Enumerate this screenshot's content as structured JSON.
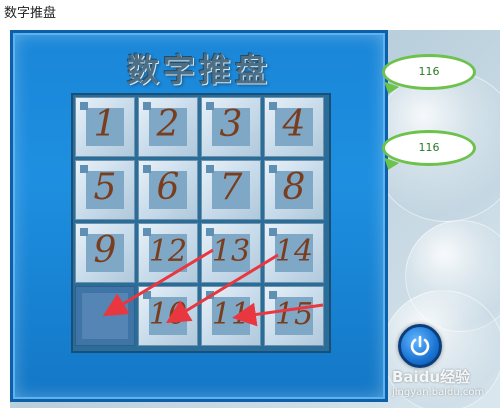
{
  "page": {
    "title": "数字推盘"
  },
  "game": {
    "title": "数字推盘",
    "tiles": [
      {
        "label": "1",
        "row": 0,
        "col": 0
      },
      {
        "label": "2",
        "row": 0,
        "col": 1
      },
      {
        "label": "3",
        "row": 0,
        "col": 2
      },
      {
        "label": "4",
        "row": 0,
        "col": 3
      },
      {
        "label": "5",
        "row": 1,
        "col": 0
      },
      {
        "label": "6",
        "row": 1,
        "col": 1
      },
      {
        "label": "7",
        "row": 1,
        "col": 2
      },
      {
        "label": "8",
        "row": 1,
        "col": 3
      },
      {
        "label": "9",
        "row": 2,
        "col": 0
      },
      {
        "label": "12",
        "row": 2,
        "col": 1
      },
      {
        "label": "13",
        "row": 2,
        "col": 2
      },
      {
        "label": "14",
        "row": 2,
        "col": 3
      },
      {
        "label": "10",
        "row": 3,
        "col": 1
      },
      {
        "label": "11",
        "row": 3,
        "col": 2
      },
      {
        "label": "15",
        "row": 3,
        "col": 3
      }
    ],
    "empty_cell": {
      "row": 3,
      "col": 0
    }
  },
  "counters": {
    "top": "116",
    "bottom": "116"
  },
  "power_button": {
    "icon": "power-icon"
  },
  "watermark": {
    "main": "Baidu经验",
    "url": "jingyan.baidu.com"
  },
  "colors": {
    "panel": "#1e8fe0",
    "tile_number": "#7a3d1e",
    "arrow": "#e8373f",
    "speech_border": "#6cc24a"
  }
}
